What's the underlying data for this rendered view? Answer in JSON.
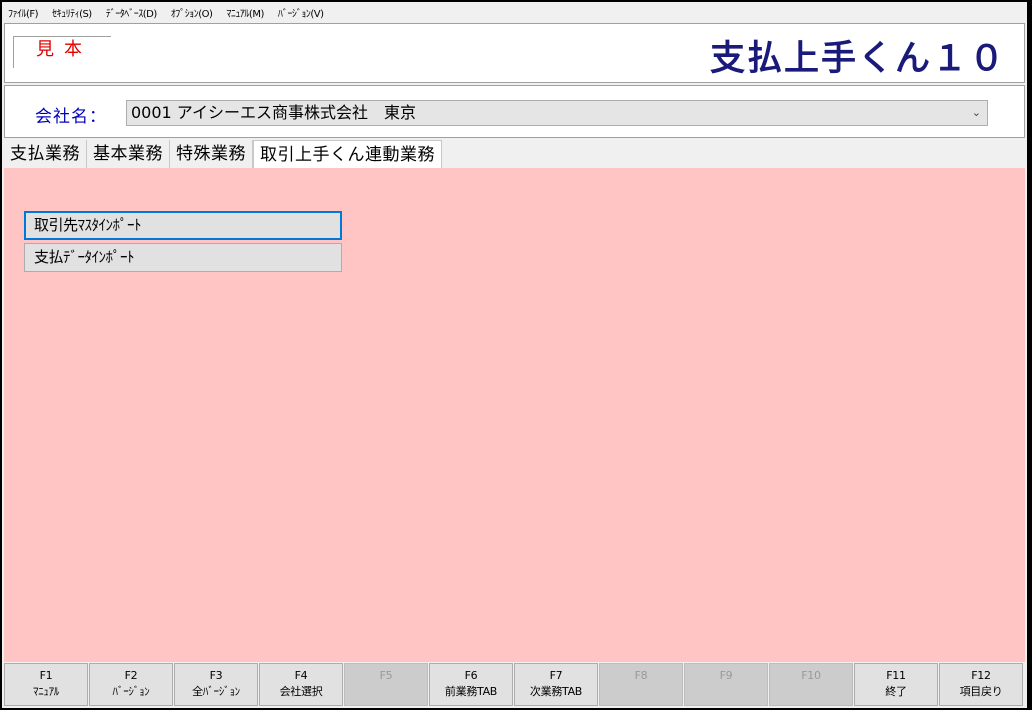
{
  "menu": [
    "ﾌｧｲﾙ(F)",
    "ｾｷｭﾘﾃｨ(S)",
    "ﾃﾞｰﾀﾍﾞｰｽ(D)",
    "ｵﾌﾟｼｮﾝ(O)",
    "ﾏﾆｭｱﾙ(M)",
    "ﾊﾞｰｼﾞｮﾝ(V)"
  ],
  "header": {
    "sample_label": "見本",
    "app_title": "支払上手くん１０"
  },
  "company": {
    "label": "会社名：",
    "value": "0001 アイシーエス商事株式会社　東京"
  },
  "tabs": [
    "支払業務",
    "基本業務",
    "特殊業務",
    "取引上手くん連動業務"
  ],
  "active_tab": 3,
  "actions": [
    "取引先ﾏｽﾀｲﾝﾎﾟｰﾄ",
    "支払ﾃﾞｰﾀｲﾝﾎﾟｰﾄ"
  ],
  "fkeys": [
    {
      "key": "F1",
      "label": "ﾏﾆｭｱﾙ"
    },
    {
      "key": "F2",
      "label": "ﾊﾞｰｼﾞｮﾝ"
    },
    {
      "key": "F3",
      "label": "全ﾊﾞｰｼﾞｮﾝ"
    },
    {
      "key": "F4",
      "label": "会社選択"
    },
    {
      "key": "F5",
      "label": ""
    },
    {
      "key": "F6",
      "label": "前業務TAB"
    },
    {
      "key": "F7",
      "label": "次業務TAB"
    },
    {
      "key": "F8",
      "label": ""
    },
    {
      "key": "F9",
      "label": ""
    },
    {
      "key": "F10",
      "label": ""
    },
    {
      "key": "F11",
      "label": "終了"
    },
    {
      "key": "F12",
      "label": "項目戻り"
    }
  ],
  "colors": {
    "content_bg": "#ffc4c4",
    "title": "#1a1a7a",
    "sample": "#e00000",
    "company_label": "#0000c0"
  }
}
